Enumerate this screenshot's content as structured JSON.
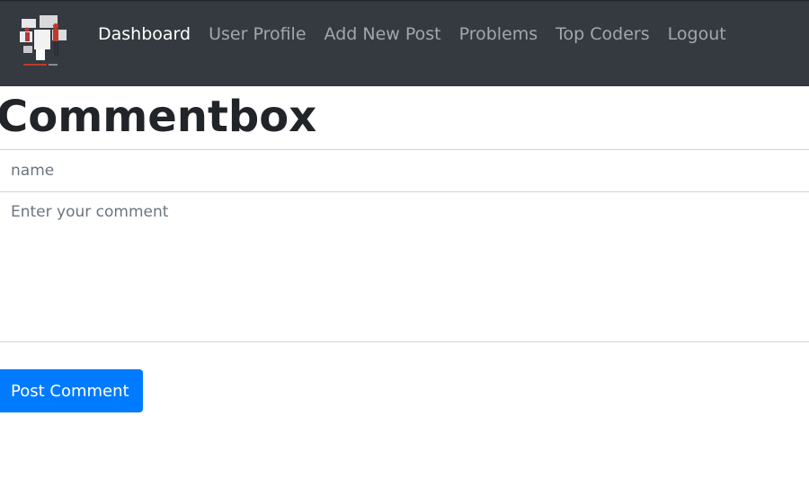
{
  "nav": {
    "logo_icon": "site-logo-illustration",
    "items": [
      {
        "label": "Dashboard",
        "active": true
      },
      {
        "label": "User Profile",
        "active": false
      },
      {
        "label": "Add New Post",
        "active": false
      },
      {
        "label": "Problems",
        "active": false
      },
      {
        "label": "Top Coders",
        "active": false
      },
      {
        "label": "Logout",
        "active": false
      }
    ]
  },
  "page": {
    "title": "Commentbox"
  },
  "form": {
    "name_placeholder": "name",
    "name_value": "",
    "comment_placeholder": "Enter your comment",
    "comment_value": "",
    "submit_label": "Post Comment"
  },
  "colors": {
    "navbar_bg": "#343a40",
    "primary": "#007bff",
    "text": "#212529"
  }
}
